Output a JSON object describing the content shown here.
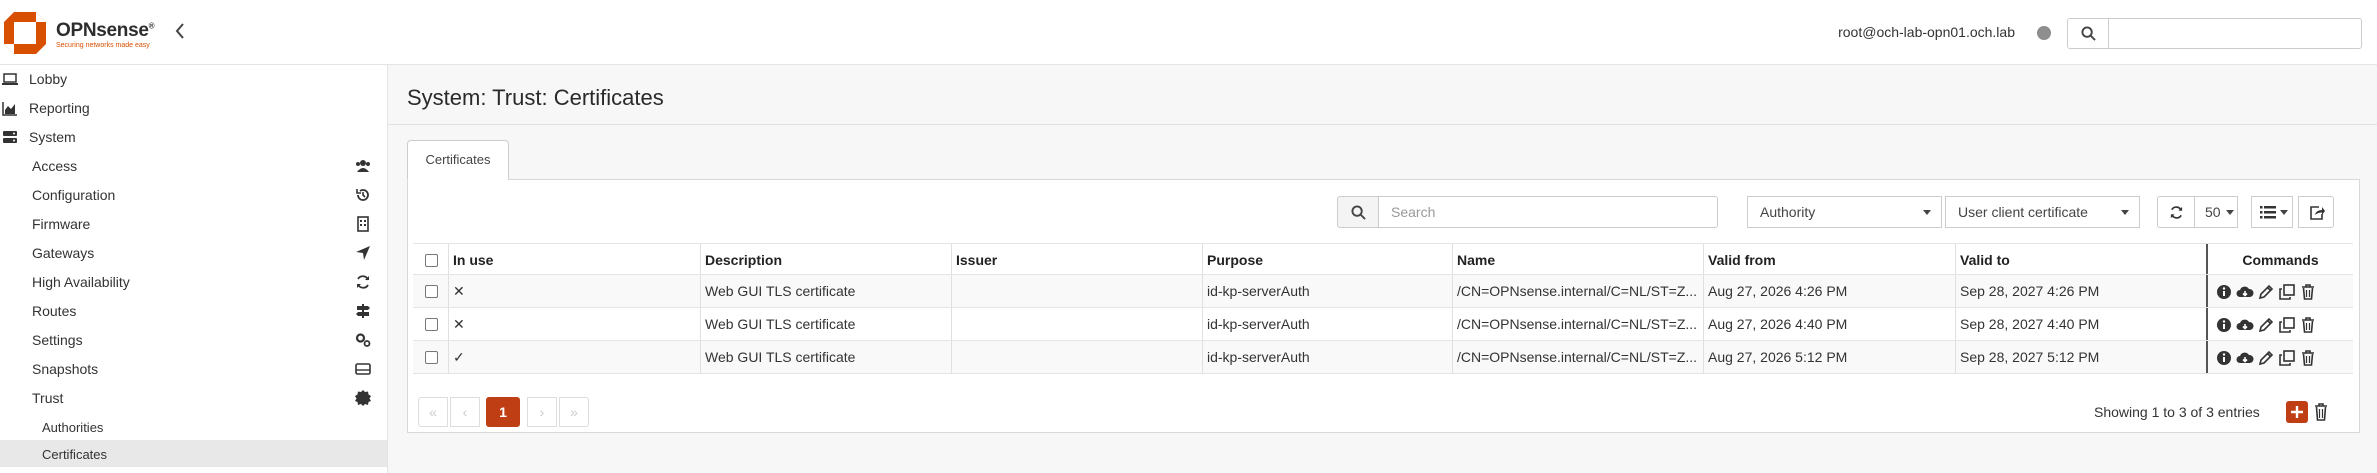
{
  "header": {
    "brand": "OPNsense",
    "brand_mark": "®",
    "tagline": "Securing networks made easy",
    "user": "root@och-lab-opn01.och.lab",
    "status_color": "#8e8e8e",
    "search_value": ""
  },
  "sidebar": {
    "top": [
      {
        "label": "Lobby",
        "icon": "laptop-icon"
      },
      {
        "label": "Reporting",
        "icon": "area-chart-icon"
      },
      {
        "label": "System",
        "icon": "server-icon"
      }
    ],
    "system_items": [
      {
        "label": "Access",
        "icon": "users-icon"
      },
      {
        "label": "Configuration",
        "icon": "history-icon"
      },
      {
        "label": "Firmware",
        "icon": "building-icon"
      },
      {
        "label": "Gateways",
        "icon": "location-arrow-icon"
      },
      {
        "label": "High Availability",
        "icon": "refresh-icon"
      },
      {
        "label": "Routes",
        "icon": "map-signs-icon"
      },
      {
        "label": "Settings",
        "icon": "cogs-icon"
      },
      {
        "label": "Snapshots",
        "icon": "hdd-icon"
      },
      {
        "label": "Trust",
        "icon": "certificate-icon"
      }
    ],
    "trust_items": [
      {
        "label": "Authorities",
        "active": false
      },
      {
        "label": "Certificates",
        "active": true
      }
    ]
  },
  "page": {
    "title": "System: Trust: Certificates",
    "tab": "Certificates"
  },
  "toolbar": {
    "search_placeholder": "Search",
    "filter_authority": "Authority",
    "filter_type": "User client certificate",
    "page_size": "50"
  },
  "table": {
    "columns": [
      "In use",
      "Description",
      "Issuer",
      "Purpose",
      "Name",
      "Valid from",
      "Valid to",
      "Commands"
    ],
    "rows": [
      {
        "in_use": "✕",
        "description": "Web GUI TLS certificate",
        "issuer": "",
        "purpose": "id-kp-serverAuth",
        "name": "/CN=OPNsense.internal/C=NL/ST=Z...",
        "valid_from": "Aug 27, 2026 4:26 PM",
        "valid_to": "Sep 28, 2027 4:26 PM"
      },
      {
        "in_use": "✕",
        "description": "Web GUI TLS certificate",
        "issuer": "",
        "purpose": "id-kp-serverAuth",
        "name": "/CN=OPNsense.internal/C=NL/ST=Z...",
        "valid_from": "Aug 27, 2026 4:40 PM",
        "valid_to": "Sep 28, 2027 4:40 PM"
      },
      {
        "in_use": "✓",
        "description": "Web GUI TLS certificate",
        "issuer": "",
        "purpose": "id-kp-serverAuth",
        "name": "/CN=OPNsense.internal/C=NL/ST=Z...",
        "valid_from": "Aug 27, 2026 5:12 PM",
        "valid_to": "Sep 28, 2027 5:12 PM"
      }
    ]
  },
  "pagination": {
    "first": "«",
    "prev": "‹",
    "current": "1",
    "next": "›",
    "last": "»",
    "info": "Showing 1 to 3 of 3 entries"
  },
  "colors": {
    "accent": "#c03e14",
    "brand_orange": "#d94f00"
  }
}
